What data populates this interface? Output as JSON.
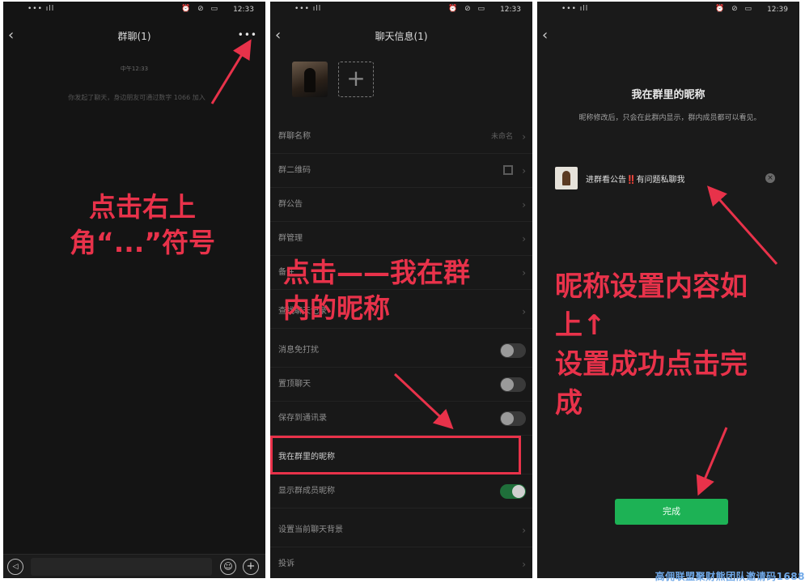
{
  "status_bar": {
    "left": "••• ıll",
    "icons": "⏰ ⊘ ▭",
    "time_1": "12:33",
    "time_2": "12:33",
    "time_3": "12:39"
  },
  "panel1": {
    "title": "群聊(1)",
    "more": "•••",
    "system_time": "中午12:33",
    "system_message": "你发起了聊天，身边朋友可通过数字 1066 加入",
    "instruction": [
      "点击右上",
      "角“...”符号"
    ]
  },
  "panel2": {
    "title": "聊天信息(1)",
    "add_member": "+",
    "rows": [
      {
        "label": "群聊名称",
        "value": "未命名"
      },
      {
        "label": "群二维码"
      },
      {
        "label": "群公告"
      },
      {
        "label": "群管理"
      },
      {
        "label": "备注"
      },
      {
        "label": "查找聊天记录"
      },
      {
        "label": "消息免打扰",
        "toggle": false
      },
      {
        "label": "置顶聊天",
        "toggle": false
      },
      {
        "label": "保存到通讯录",
        "toggle": false
      },
      {
        "label": "我在群里的昵称"
      },
      {
        "label": "显示群成员昵称",
        "toggle": true
      },
      {
        "label": "设置当前聊天背景"
      },
      {
        "label": "投诉"
      }
    ],
    "instruction": [
      "点击——我在群",
      "内的昵称"
    ]
  },
  "panel3": {
    "title": "我在群里的昵称",
    "description": "昵称修改后，只会在此群内显示，群内成员都可以看见。",
    "nickname": "进群看公告‼️有问题私聊我",
    "clear": "×",
    "done": "完成",
    "instruction": [
      "昵称设置内容如",
      "上↑",
      "设置成功点击完",
      "成"
    ]
  },
  "watermark": "高佣联盟聚财熊团队邀请码1688",
  "colors": {
    "annotation": "#e8324a",
    "done_button": "#1db255",
    "watermark": "#6fa8e8"
  }
}
